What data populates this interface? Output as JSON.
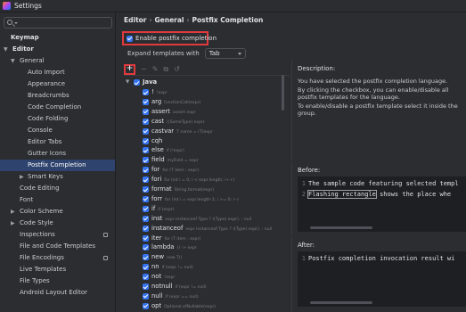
{
  "window": {
    "title": "Settings"
  },
  "sidebar": {
    "search_placeholder": "",
    "items": [
      {
        "label": "Keymap",
        "level": 0,
        "bold": true
      },
      {
        "label": "Editor",
        "level": 0,
        "bold": true,
        "expanded": true
      },
      {
        "label": "General",
        "level": 1,
        "expanded": true
      },
      {
        "label": "Auto Import",
        "level": 2
      },
      {
        "label": "Appearance",
        "level": 2
      },
      {
        "label": "Breadcrumbs",
        "level": 2
      },
      {
        "label": "Code Completion",
        "level": 2
      },
      {
        "label": "Code Folding",
        "level": 2
      },
      {
        "label": "Console",
        "level": 2
      },
      {
        "label": "Editor Tabs",
        "level": 2
      },
      {
        "label": "Gutter Icons",
        "level": 2
      },
      {
        "label": "Postfix Completion",
        "level": 2,
        "selected": true
      },
      {
        "label": "Smart Keys",
        "level": 2,
        "collapsed": true
      },
      {
        "label": "Code Editing",
        "level": 1
      },
      {
        "label": "Font",
        "level": 1
      },
      {
        "label": "Color Scheme",
        "level": 1,
        "collapsed": true
      },
      {
        "label": "Code Style",
        "level": 1,
        "collapsed": true
      },
      {
        "label": "Inspections",
        "level": 1,
        "icon": true
      },
      {
        "label": "File and Code Templates",
        "level": 1
      },
      {
        "label": "File Encodings",
        "level": 1,
        "icon": true
      },
      {
        "label": "Live Templates",
        "level": 1
      },
      {
        "label": "File Types",
        "level": 1
      },
      {
        "label": "Android Layout Editor",
        "level": 1
      }
    ]
  },
  "breadcrumb": [
    "Editor",
    "General",
    "Postfix Completion"
  ],
  "enable_checkbox": {
    "label": "Enable postfix completion",
    "checked": true
  },
  "expand_templates": {
    "label": "Expand templates with",
    "value": "Tab"
  },
  "templates": {
    "group": "Java",
    "items": [
      {
        "key": "!",
        "example": "!expr"
      },
      {
        "key": "arg",
        "example": "functionCall(expr)"
      },
      {
        "key": "assert",
        "example": "assert expr"
      },
      {
        "key": "cast",
        "example": "((SomeType) expr)"
      },
      {
        "key": "castvar",
        "example": "T name = (T)expr"
      },
      {
        "key": "cqh",
        "example": ""
      },
      {
        "key": "else",
        "example": "if (!expr)"
      },
      {
        "key": "field",
        "example": "myField = expr"
      },
      {
        "key": "for",
        "example": "for (T item : expr)"
      },
      {
        "key": "fori",
        "example": "for (int i = 0; i < expr.length; i++)"
      },
      {
        "key": "format",
        "example": "String.format(expr)"
      },
      {
        "key": "forr",
        "example": "for (int i = expr.length-1; i >= 0; i--)"
      },
      {
        "key": "if",
        "example": "if (expr)"
      },
      {
        "key": "inst",
        "example": "expr instanceof Type ? ((Type) expr). : null"
      },
      {
        "key": "instanceof",
        "example": "expr instanceof Type ? ((Type) expr). : null"
      },
      {
        "key": "iter",
        "example": "for (T item : expr)"
      },
      {
        "key": "lambda",
        "example": "() -> expr"
      },
      {
        "key": "new",
        "example": "new T()"
      },
      {
        "key": "nn",
        "example": "if (expr != null)"
      },
      {
        "key": "not",
        "example": "!expr"
      },
      {
        "key": "notnull",
        "example": "if (expr != null)"
      },
      {
        "key": "null",
        "example": "if (expr == null)"
      },
      {
        "key": "opt",
        "example": "Optional.ofNullable(expr)"
      }
    ]
  },
  "description": {
    "title": "Description:",
    "paragraphs": [
      "You have selected the postfix completion language.",
      "By clicking the checkbox, you can enable/disable all postfix templates for the language.",
      "To enable/disable a postfix template select it inside the group."
    ]
  },
  "before": {
    "title": "Before:",
    "lines": [
      {
        "num": "1",
        "text": "The sample code featuring selected templ"
      },
      {
        "num": "2",
        "text_highlight": "Flashing rectangle",
        "text_rest": " shows the place whe"
      }
    ]
  },
  "after": {
    "title": "After:",
    "lines": [
      {
        "num": "1",
        "text": "Postfix completion invocation result wi"
      }
    ]
  },
  "colors": {
    "background": "#2b2d30",
    "selection": "#2e436e",
    "accent_blue": "#3574f0",
    "highlight_red": "#e03a3e",
    "editor_bg": "#1e1f22"
  }
}
